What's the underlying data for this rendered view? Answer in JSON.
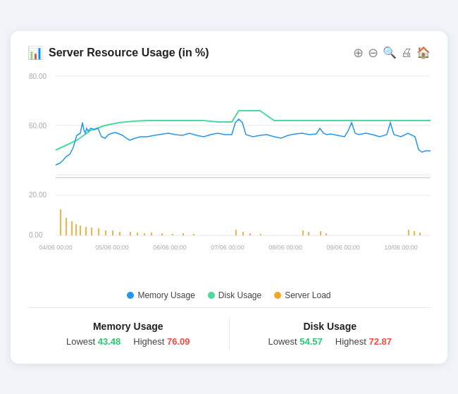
{
  "header": {
    "title": "Server Resource Usage (in %)",
    "icon": "bar-chart-icon"
  },
  "toolbar": {
    "zoom_in": "⊕",
    "zoom_out": "⊖",
    "search": "🔍",
    "print": "🖨",
    "home": "🏠"
  },
  "chart": {
    "y_max_top": "80.00",
    "y_mid_top": "60.00",
    "y_max_bottom": "20.00",
    "y_mid_bottom": "0.00",
    "x_labels": [
      "04/06 00:00",
      "05/06 00:00",
      "06/06 00:00",
      "07/06 00:00",
      "08/06 00:00",
      "09/06 00:00",
      "10/06 00:00"
    ]
  },
  "legend": {
    "items": [
      {
        "label": "Memory Usage",
        "color": "#2196f3"
      },
      {
        "label": "Disk Usage",
        "color": "#4cdb9e"
      },
      {
        "label": "Server Load",
        "color": "#f5a623"
      }
    ]
  },
  "stats": {
    "memory": {
      "title": "Memory Usage",
      "lowest_label": "Lowest",
      "lowest_value": "43.48",
      "highest_label": "Highest",
      "highest_value": "76.09"
    },
    "disk": {
      "title": "Disk Usage",
      "lowest_label": "Lowest",
      "lowest_value": "54.57",
      "highest_label": "Highest",
      "highest_value": "72.87"
    }
  }
}
